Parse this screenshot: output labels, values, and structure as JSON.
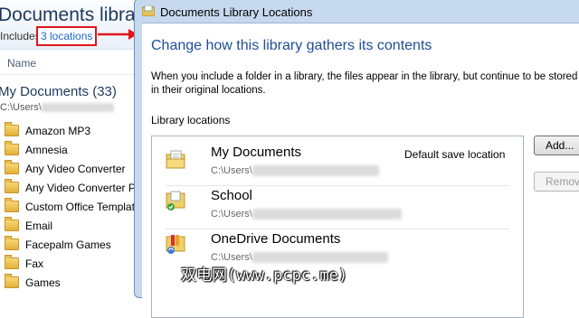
{
  "explorer": {
    "title": "Documents library",
    "includes_label": "Includes:",
    "locations_link": "3 locations",
    "column_name": "Name",
    "group_header": "My Documents (33)",
    "group_path": "C:\\Users\\",
    "items": [
      "Amazon MP3",
      "Amnesia",
      "Any Video Converter",
      "Any Video Converter Pr",
      "Custom Office Templat",
      "Email",
      "Facepalm Games",
      "Fax",
      "Games"
    ]
  },
  "dialog": {
    "title": "Documents Library Locations",
    "heading": "Change how this library gathers its contents",
    "description": "When you include a folder in a library, the files appear in the library, but continue to be stored in their original locations.",
    "locations_label": "Library locations",
    "locations": [
      {
        "name": "My Documents",
        "path": "C:\\Users\\",
        "badge": "Default save location",
        "icon": "documents-folder-icon"
      },
      {
        "name": "School",
        "path": "C:\\Users\\",
        "badge": "",
        "icon": "folder-check-icon"
      },
      {
        "name": "OneDrive Documents",
        "path": "C:\\Users\\",
        "badge": "",
        "icon": "folder-sync-icon"
      }
    ],
    "add_button": "Add...",
    "remove_button": "Remove"
  },
  "watermark": "双电网(www.pcpc.me)",
  "colors": {
    "highlight_red": "#e0161b",
    "link_blue": "#1f67c7",
    "heading_blue": "#1e4e96"
  }
}
